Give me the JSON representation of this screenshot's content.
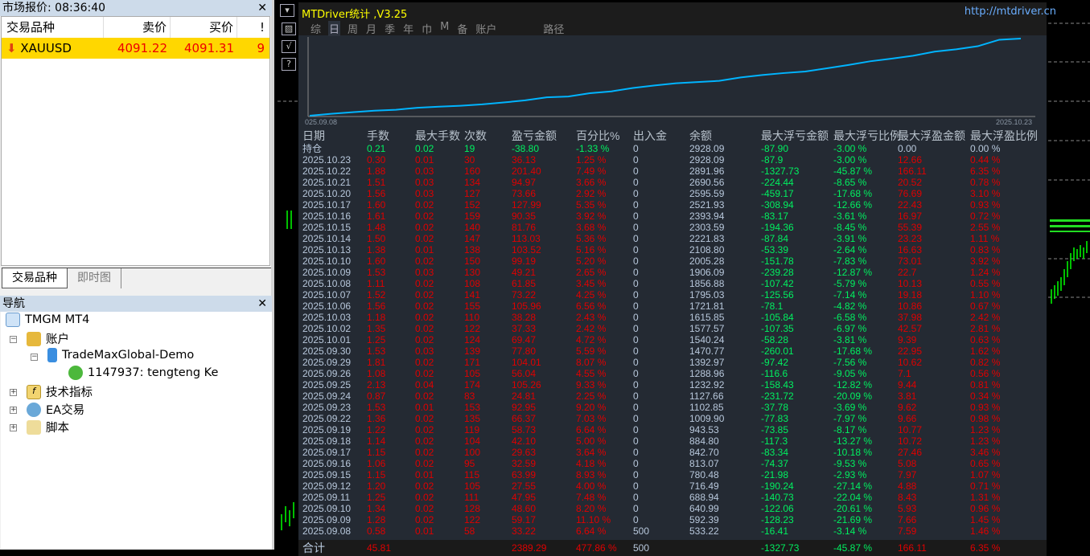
{
  "market": {
    "title": "市场报价: 08:36:40",
    "cols": [
      "交易品种",
      "卖价",
      "买价",
      "!"
    ],
    "symbol": "XAUUSD",
    "bid": "4091.22",
    "ask": "4091.31",
    "spread": "9"
  },
  "tabs": [
    "交易品种",
    "即时图"
  ],
  "nav": {
    "title": "导航",
    "root": "TMGM MT4",
    "accounts": "账户",
    "server": "TradeMaxGlobal-Demo",
    "account": "1147937: tengteng Ke",
    "indicators": "技术指标",
    "ea": "EA交易",
    "scripts": "脚本"
  },
  "panel": {
    "title": "MTDriver统计 ,V3.25",
    "url": "http://mtdriver.cn",
    "menu": [
      "综",
      "日",
      "周",
      "月",
      "季",
      "年",
      "巾",
      "M",
      "备",
      "账户",
      "路径"
    ],
    "chart_start": "025.09.08",
    "chart_end": "2025.10.23"
  },
  "headers": [
    "日期",
    "手数",
    "最大手数",
    "次数",
    "盈亏金额",
    "百分比%",
    "出入金",
    "余额",
    "最大浮亏金额",
    "最大浮亏比例",
    "最大浮盈金额",
    "最大浮盈比例"
  ],
  "holding": [
    "持仓",
    "0.21",
    "0.02",
    "19",
    "-38.80",
    "-1.33 %",
    "0",
    "2928.09",
    "-87.90",
    "-3.00 %",
    "0.00",
    "0.00 %"
  ],
  "rows": [
    [
      "2025.10.23",
      "0.30",
      "0.01",
      "30",
      "36.13",
      "1.25 %",
      "0",
      "2928.09",
      "-87.9",
      "-3.00 %",
      "12.66",
      "0.44 %"
    ],
    [
      "2025.10.22",
      "1.88",
      "0.03",
      "160",
      "201.40",
      "7.49 %",
      "0",
      "2891.96",
      "-1327.73",
      "-45.87 %",
      "166.11",
      "6.35 %"
    ],
    [
      "2025.10.21",
      "1.51",
      "0.03",
      "134",
      "94.97",
      "3.66 %",
      "0",
      "2690.56",
      "-224.44",
      "-8.65 %",
      "20.52",
      "0.78 %"
    ],
    [
      "2025.10.20",
      "1.56",
      "0.03",
      "127",
      "73.66",
      "2.92 %",
      "0",
      "2595.59",
      "-459.17",
      "-17.68 %",
      "76.69",
      "3.10 %"
    ],
    [
      "2025.10.17",
      "1.60",
      "0.02",
      "152",
      "127.99",
      "5.35 %",
      "0",
      "2521.93",
      "-308.94",
      "-12.66 %",
      "22.43",
      "0.93 %"
    ],
    [
      "2025.10.16",
      "1.61",
      "0.02",
      "159",
      "90.35",
      "3.92 %",
      "0",
      "2393.94",
      "-83.17",
      "-3.61 %",
      "16.97",
      "0.72 %"
    ],
    [
      "2025.10.15",
      "1.48",
      "0.02",
      "140",
      "81.76",
      "3.68 %",
      "0",
      "2303.59",
      "-194.36",
      "-8.45 %",
      "55.39",
      "2.55 %"
    ],
    [
      "2025.10.14",
      "1.50",
      "0.02",
      "147",
      "113.03",
      "5.36 %",
      "0",
      "2221.83",
      "-87.84",
      "-3.91 %",
      "23.23",
      "1.11 %"
    ],
    [
      "2025.10.13",
      "1.38",
      "0.01",
      "138",
      "103.52",
      "5.16 %",
      "0",
      "2108.80",
      "-53.39",
      "-2.64 %",
      "16.63",
      "0.83 %"
    ],
    [
      "2025.10.10",
      "1.60",
      "0.02",
      "150",
      "99.19",
      "5.20 %",
      "0",
      "2005.28",
      "-151.78",
      "-7.83 %",
      "73.01",
      "3.92 %"
    ],
    [
      "2025.10.09",
      "1.53",
      "0.03",
      "130",
      "49.21",
      "2.65 %",
      "0",
      "1906.09",
      "-239.28",
      "-12.87 %",
      "22.7",
      "1.24 %"
    ],
    [
      "2025.10.08",
      "1.11",
      "0.02",
      "108",
      "61.85",
      "3.45 %",
      "0",
      "1856.88",
      "-107.42",
      "-5.79 %",
      "10.13",
      "0.55 %"
    ],
    [
      "2025.10.07",
      "1.52",
      "0.02",
      "141",
      "73.22",
      "4.25 %",
      "0",
      "1795.03",
      "-125.56",
      "-7.14 %",
      "19.18",
      "1.10 %"
    ],
    [
      "2025.10.06",
      "1.56",
      "0.02",
      "155",
      "105.96",
      "6.56 %",
      "0",
      "1721.81",
      "-78.1",
      "-4.82 %",
      "10.86",
      "0.67 %"
    ],
    [
      "2025.10.03",
      "1.18",
      "0.02",
      "110",
      "38.28",
      "2.43 %",
      "0",
      "1615.85",
      "-105.84",
      "-6.58 %",
      "37.98",
      "2.42 %"
    ],
    [
      "2025.10.02",
      "1.35",
      "0.02",
      "122",
      "37.33",
      "2.42 %",
      "0",
      "1577.57",
      "-107.35",
      "-6.97 %",
      "42.57",
      "2.81 %"
    ],
    [
      "2025.10.01",
      "1.25",
      "0.02",
      "124",
      "69.47",
      "4.72 %",
      "0",
      "1540.24",
      "-58.28",
      "-3.81 %",
      "9.39",
      "0.63 %"
    ],
    [
      "2025.09.30",
      "1.53",
      "0.03",
      "139",
      "77.80",
      "5.59 %",
      "0",
      "1470.77",
      "-260.01",
      "-17.68 %",
      "22.95",
      "1.62 %"
    ],
    [
      "2025.09.29",
      "1.81",
      "0.02",
      "171",
      "104.01",
      "8.07 %",
      "0",
      "1392.97",
      "-97.42",
      "-7.56 %",
      "10.62",
      "0.82 %"
    ],
    [
      "2025.09.26",
      "1.08",
      "0.02",
      "105",
      "56.04",
      "4.55 %",
      "0",
      "1288.96",
      "-116.6",
      "-9.05 %",
      "7.1",
      "0.56 %"
    ],
    [
      "2025.09.25",
      "2.13",
      "0.04",
      "174",
      "105.26",
      "9.33 %",
      "0",
      "1232.92",
      "-158.43",
      "-12.82 %",
      "9.44",
      "0.81 %"
    ],
    [
      "2025.09.24",
      "0.87",
      "0.02",
      "83",
      "24.81",
      "2.25 %",
      "0",
      "1127.66",
      "-231.72",
      "-20.09 %",
      "3.81",
      "0.34 %"
    ],
    [
      "2025.09.23",
      "1.53",
      "0.01",
      "153",
      "92.95",
      "9.20 %",
      "0",
      "1102.85",
      "-37.78",
      "-3.69 %",
      "9.62",
      "0.93 %"
    ],
    [
      "2025.09.22",
      "1.36",
      "0.02",
      "135",
      "66.37",
      "7.03 %",
      "0",
      "1009.90",
      "-77.83",
      "-7.97 %",
      "9.66",
      "0.98 %"
    ],
    [
      "2025.09.19",
      "1.22",
      "0.02",
      "119",
      "58.73",
      "6.64 %",
      "0",
      "943.53",
      "-73.85",
      "-8.17 %",
      "10.77",
      "1.23 %"
    ],
    [
      "2025.09.18",
      "1.14",
      "0.02",
      "104",
      "42.10",
      "5.00 %",
      "0",
      "884.80",
      "-117.3",
      "-13.27 %",
      "10.72",
      "1.23 %"
    ],
    [
      "2025.09.17",
      "1.15",
      "0.02",
      "100",
      "29.63",
      "3.64 %",
      "0",
      "842.70",
      "-83.34",
      "-10.18 %",
      "27.46",
      "3.46 %"
    ],
    [
      "2025.09.16",
      "1.06",
      "0.02",
      "95",
      "32.59",
      "4.18 %",
      "0",
      "813.07",
      "-74.37",
      "-9.53 %",
      "5.08",
      "0.65 %"
    ],
    [
      "2025.09.15",
      "1.15",
      "0.01",
      "115",
      "63.99",
      "8.93 %",
      "0",
      "780.48",
      "-21.98",
      "-2.93 %",
      "7.97",
      "1.07 %"
    ],
    [
      "2025.09.12",
      "1.20",
      "0.02",
      "105",
      "27.55",
      "4.00 %",
      "0",
      "716.49",
      "-190.24",
      "-27.14 %",
      "4.88",
      "0.71 %"
    ],
    [
      "2025.09.11",
      "1.25",
      "0.02",
      "111",
      "47.95",
      "7.48 %",
      "0",
      "688.94",
      "-140.73",
      "-22.04 %",
      "8.43",
      "1.31 %"
    ],
    [
      "2025.09.10",
      "1.34",
      "0.02",
      "128",
      "48.60",
      "8.20 %",
      "0",
      "640.99",
      "-122.06",
      "-20.61 %",
      "5.93",
      "0.96 %"
    ],
    [
      "2025.09.09",
      "1.28",
      "0.02",
      "122",
      "59.17",
      "11.10 %",
      "0",
      "592.39",
      "-128.23",
      "-21.69 %",
      "7.66",
      "1.45 %"
    ],
    [
      "2025.09.08",
      "0.58",
      "0.01",
      "58",
      "33.22",
      "6.64 %",
      "500",
      "533.22",
      "-16.41",
      "-3.14 %",
      "7.59",
      "1.46 %"
    ]
  ],
  "total": [
    "合计",
    "45.81",
    "",
    "",
    "2389.29",
    "477.86 %",
    "500",
    "",
    "-1327.73",
    "-45.87 %",
    "166.11",
    "6.35 %"
  ],
  "colors": {
    "loss": "#00f060",
    "profit": "#e00000",
    "neutral": "#b8c8dc",
    "curve": "#00b4ff"
  }
}
